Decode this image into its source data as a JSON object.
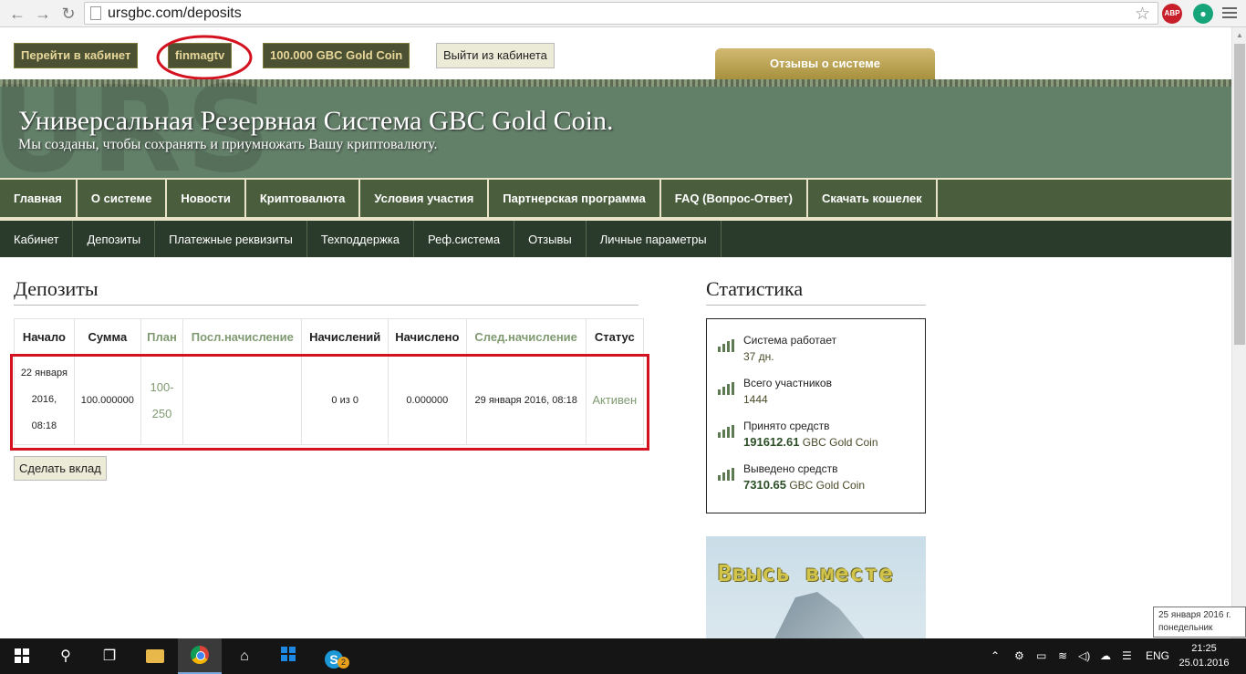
{
  "browser": {
    "url": "ursgbc.com/deposits",
    "abp_label": "ABP"
  },
  "topbar": {
    "cabinet_btn": "Перейти в кабинет",
    "username": "finmagtv",
    "balance": "100.000 GBC Gold Coin",
    "logout_btn": "Выйти из кабинета",
    "reviews_tab": "Отзывы о системе"
  },
  "header": {
    "title": "Универсальная Резервная Система GBC Gold Coin.",
    "subtitle": "Мы созданы, чтобы сохранять и приумножать Вашу криптовалюту."
  },
  "mainnav": [
    "Главная",
    "О системе",
    "Новости",
    "Криптовалюта",
    "Условия участия",
    "Партнерская программа",
    "FAQ (Вопрос-Ответ)",
    "Скачать кошелек"
  ],
  "subnav": [
    "Кабинет",
    "Депозиты",
    "Платежные реквизиты",
    "Техподдержка",
    "Реф.система",
    "Отзывы",
    "Личные параметры"
  ],
  "deposits": {
    "title": "Депозиты",
    "headers": [
      "Начало",
      "Сумма",
      "План",
      "Посл.начисление",
      "Начислений",
      "Начислено",
      "След.начисление",
      "Статус"
    ],
    "row": {
      "date1": "22 января",
      "date2": "2016,",
      "date3": "08:18",
      "amount": "100.000000",
      "plan1": "100-",
      "plan2": "250",
      "last": "",
      "count": "0 из 0",
      "accrued": "0.000000",
      "next": "29 января 2016, 08:18",
      "status": "Активен"
    },
    "invest_btn": "Сделать вклад"
  },
  "stats": {
    "title": "Статистика",
    "items": [
      {
        "label": "Система работает",
        "value": "37 дн.",
        "suffix": ""
      },
      {
        "label": "Всего участников",
        "value": "1444",
        "suffix": ""
      },
      {
        "label": "Принято средств",
        "value": "191612.61",
        "suffix": " GBC Gold Coin"
      },
      {
        "label": "Выведено средств",
        "value": "7310.65",
        "suffix": " GBC Gold Coin"
      }
    ]
  },
  "banner": {
    "text": "Ввысь вместе"
  },
  "tooltip": {
    "line1": "25 января 2016 г.",
    "line2": "понедельник"
  },
  "taskbar": {
    "lang": "ENG",
    "time": "21:25",
    "date": "25.01.2016",
    "skype_badge": "2"
  }
}
